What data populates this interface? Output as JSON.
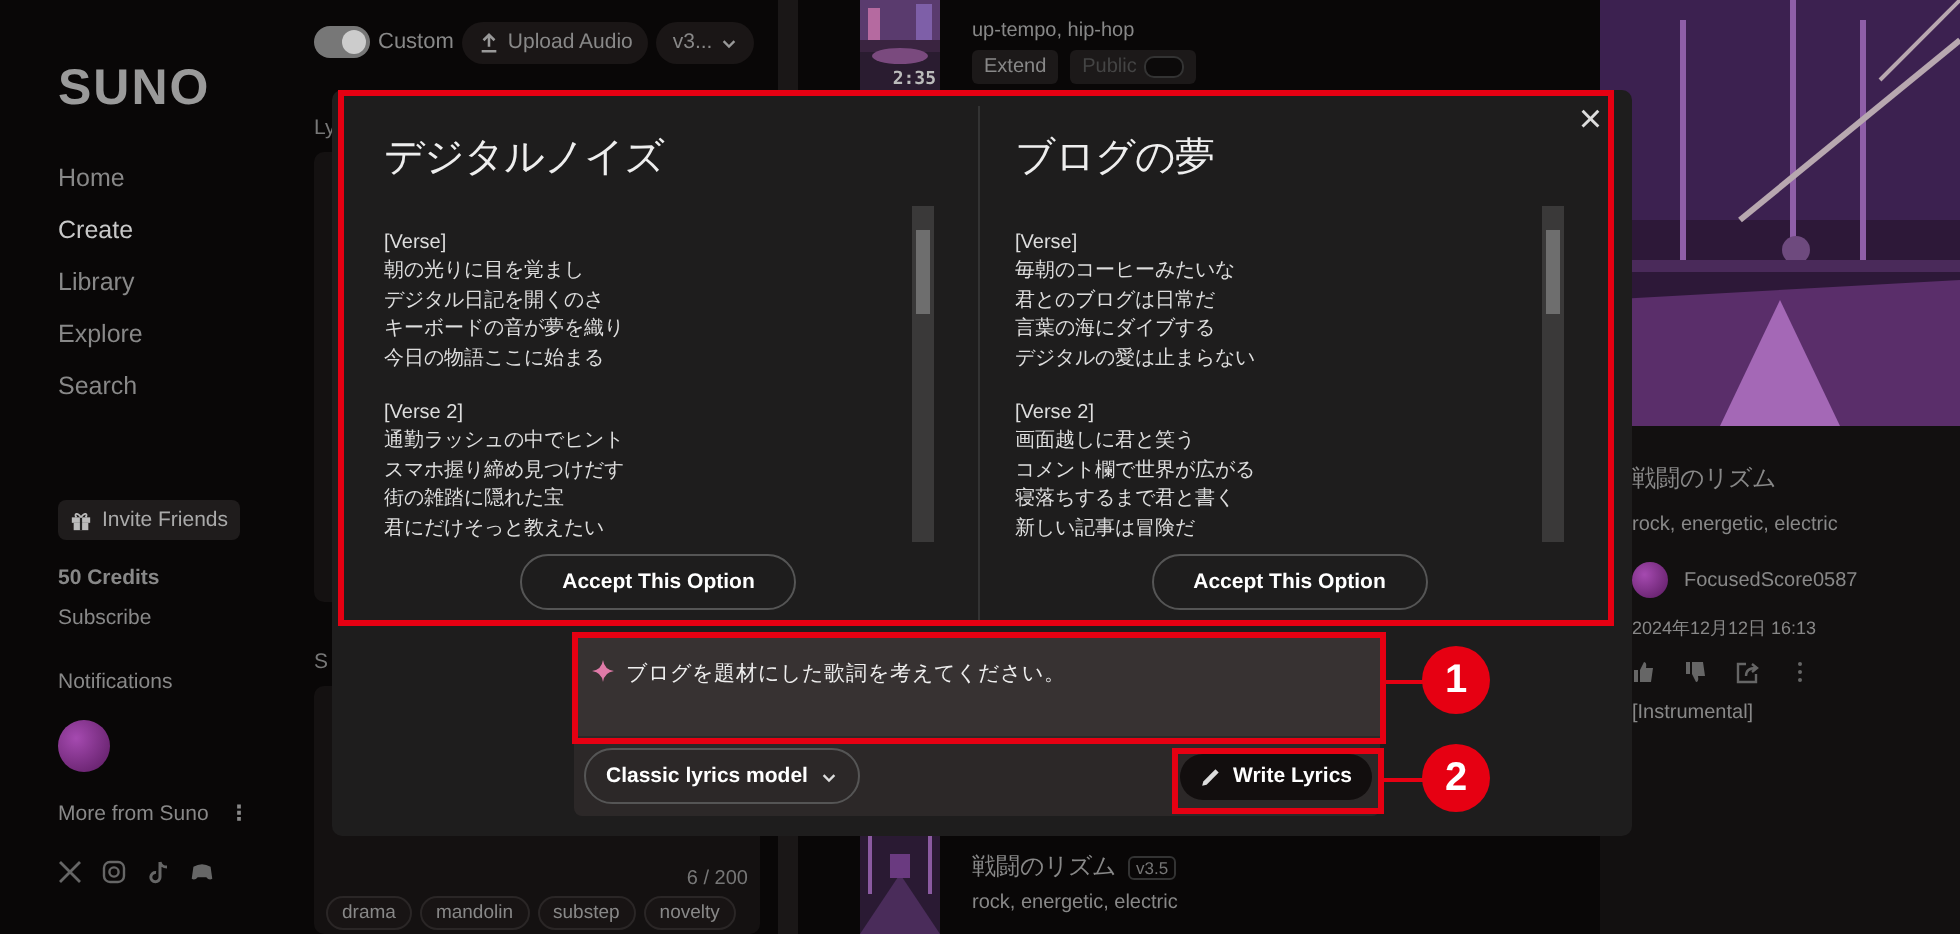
{
  "sidebar": {
    "logo": "SUNO",
    "nav": [
      {
        "label": "Home",
        "selected": false
      },
      {
        "label": "Create",
        "selected": true
      },
      {
        "label": "Library",
        "selected": false
      },
      {
        "label": "Explore",
        "selected": false
      },
      {
        "label": "Search",
        "selected": false
      }
    ],
    "invite": "Invite Friends",
    "credits": "50 Credits",
    "subscribe": "Subscribe",
    "notifications": "Notifications",
    "more": "More from Suno",
    "more_icon": "⋮"
  },
  "create_panel": {
    "custom_toggle": {
      "label": "Custom",
      "on": true
    },
    "upload": "Upload Audio",
    "version": "v3...",
    "lyrics_label": "Ly",
    "styles_label": "S",
    "counter": "6 / 200",
    "tags": [
      "drama",
      "mandolin",
      "substep",
      "novelty"
    ]
  },
  "songs": [
    {
      "tags": "up-tempo, hip-hop",
      "duration": "2:35",
      "extend": "Extend",
      "public": {
        "label": "Public",
        "on": false
      }
    },
    {
      "title": "戦闘のリズム",
      "version": "v3.5",
      "tags": "rock, energetic, electric"
    }
  ],
  "detail": {
    "title": "戦闘のリズム",
    "tags": "rock, energetic, electric",
    "user": "FocusedScore0587",
    "date": "2024年12月12日 16:13",
    "lyrics": "[Instrumental]"
  },
  "modal": {
    "close": "×",
    "options": [
      {
        "title": "デジタルノイズ",
        "verses": [
          [
            "[Verse]",
            "朝の光りに目を覚まし",
            "デジタル日記を開くのさ",
            "キーボードの音が夢を織り",
            "今日の物語ここに始まる"
          ],
          [
            "[Verse 2]",
            "通勤ラッシュの中でヒント",
            "スマホ握り締め見つけだす",
            "街の雑踏に隠れた宝",
            "君にだけそっと教えたい"
          ]
        ],
        "accept": "Accept This Option"
      },
      {
        "title": "ブログの夢",
        "verses": [
          [
            "[Verse]",
            "毎朝のコーヒーみたいな",
            "君とのブログは日常だ",
            "言葉の海にダイブする",
            "デジタルの愛は止まらない"
          ],
          [
            "[Verse 2]",
            "画面越しに君と笑う",
            "コメント欄で世界が広がる",
            "寝落ちするまで君と書く",
            "新しい記事は冒険だ"
          ]
        ],
        "accept": "Accept This Option"
      }
    ],
    "prompt": "ブログを題材にした歌詞を考えてください。",
    "model": "Classic lyrics model",
    "write": "Write Lyrics"
  },
  "annotations": [
    "1",
    "2"
  ]
}
